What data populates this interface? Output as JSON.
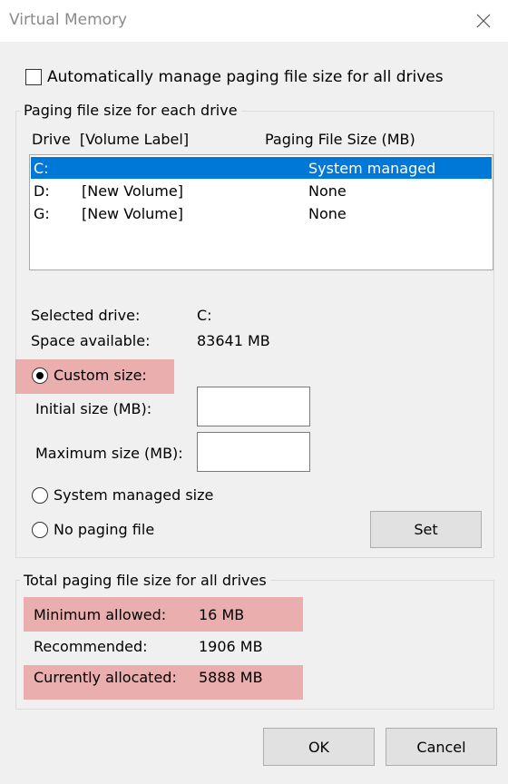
{
  "window": {
    "title": "Virtual Memory",
    "close_icon": "close-icon"
  },
  "auto_manage": {
    "label": "Automatically manage paging file size for all drives",
    "checked": false
  },
  "paging_group": {
    "title": "Paging file size for each drive",
    "columns": {
      "drive": "Drive  [Volume Label]",
      "size": "Paging File Size (MB)"
    },
    "drives": [
      {
        "drive": "C:",
        "label": "",
        "size": "System managed",
        "selected": true
      },
      {
        "drive": "D:",
        "label": "[New Volume]",
        "size": "None",
        "selected": false
      },
      {
        "drive": "G:",
        "label": "[New Volume]",
        "size": "None",
        "selected": false
      }
    ],
    "selected_drive_label": "Selected drive:",
    "selected_drive_value": "C:",
    "space_available_label": "Space available:",
    "space_available_value": "83641 MB",
    "options": {
      "custom_size": "Custom size:",
      "initial_size_label": "Initial size (MB):",
      "initial_size_value": "",
      "maximum_size_label": "Maximum size (MB):",
      "maximum_size_value": "",
      "system_managed": "System managed size",
      "no_paging": "No paging file",
      "selected_option": "custom_size"
    },
    "set_button": "Set"
  },
  "total_group": {
    "title": "Total paging file size for all drives",
    "minimum_label": "Minimum allowed:",
    "minimum_value": "16 MB",
    "recommended_label": "Recommended:",
    "recommended_value": "1906 MB",
    "allocated_label": "Currently allocated:",
    "allocated_value": "5888 MB"
  },
  "buttons": {
    "ok": "OK",
    "cancel": "Cancel"
  },
  "colors": {
    "selection": "#0078d7",
    "highlight": "#e87878"
  }
}
